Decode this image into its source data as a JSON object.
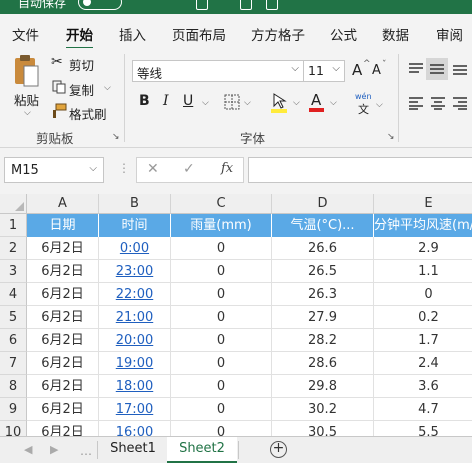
{
  "title_bar": {
    "autosave_label": "自动保存"
  },
  "tabs": [
    "文件",
    "开始",
    "插入",
    "页面布局",
    "方方格子",
    "公式",
    "数据",
    "审阅"
  ],
  "active_tab": "开始",
  "clipboard": {
    "paste": "粘贴",
    "cut": "剪切",
    "copy": "复制",
    "format_painter": "格式刷",
    "group": "剪贴板"
  },
  "font": {
    "name": "等线",
    "size": "11",
    "bold": "B",
    "italic": "I",
    "underline": "U",
    "increase": "A",
    "decrease": "A",
    "group": "字体",
    "phonetic_top": "wén",
    "phonetic_bottom": "文"
  },
  "formula_bar": {
    "name_box": "M15",
    "fx": "fx",
    "cancel": "✕",
    "enter": "✓"
  },
  "columns": [
    "A",
    "B",
    "C",
    "D",
    "E"
  ],
  "row_numbers": [
    "1",
    "2",
    "3",
    "4",
    "5",
    "6",
    "7",
    "8",
    "9",
    "10"
  ],
  "headers": [
    "日期",
    "时间",
    "雨量(mm)",
    "气温(°C)...",
    "分钟平均风速(m/s)"
  ],
  "rows": [
    [
      "6月2日",
      "0:00",
      "0",
      "26.6",
      "2.9"
    ],
    [
      "6月2日",
      "23:00",
      "0",
      "26.5",
      "1.1"
    ],
    [
      "6月2日",
      "22:00",
      "0",
      "26.3",
      "0"
    ],
    [
      "6月2日",
      "21:00",
      "0",
      "27.9",
      "0.2"
    ],
    [
      "6月2日",
      "20:00",
      "0",
      "28.2",
      "1.7"
    ],
    [
      "6月2日",
      "19:00",
      "0",
      "28.6",
      "2.4"
    ],
    [
      "6月2日",
      "18:00",
      "0",
      "29.8",
      "3.6"
    ],
    [
      "6月2日",
      "17:00",
      "0",
      "30.2",
      "4.7"
    ],
    [
      "6月2日",
      "16:00",
      "0",
      "30.5",
      "5.5"
    ]
  ],
  "sheets": [
    "Sheet1",
    "Sheet2"
  ],
  "active_sheet": "Sheet2",
  "colors": {
    "accent": "#217346",
    "header_fill": "#5aa9e6",
    "link": "#1f5fbf"
  }
}
